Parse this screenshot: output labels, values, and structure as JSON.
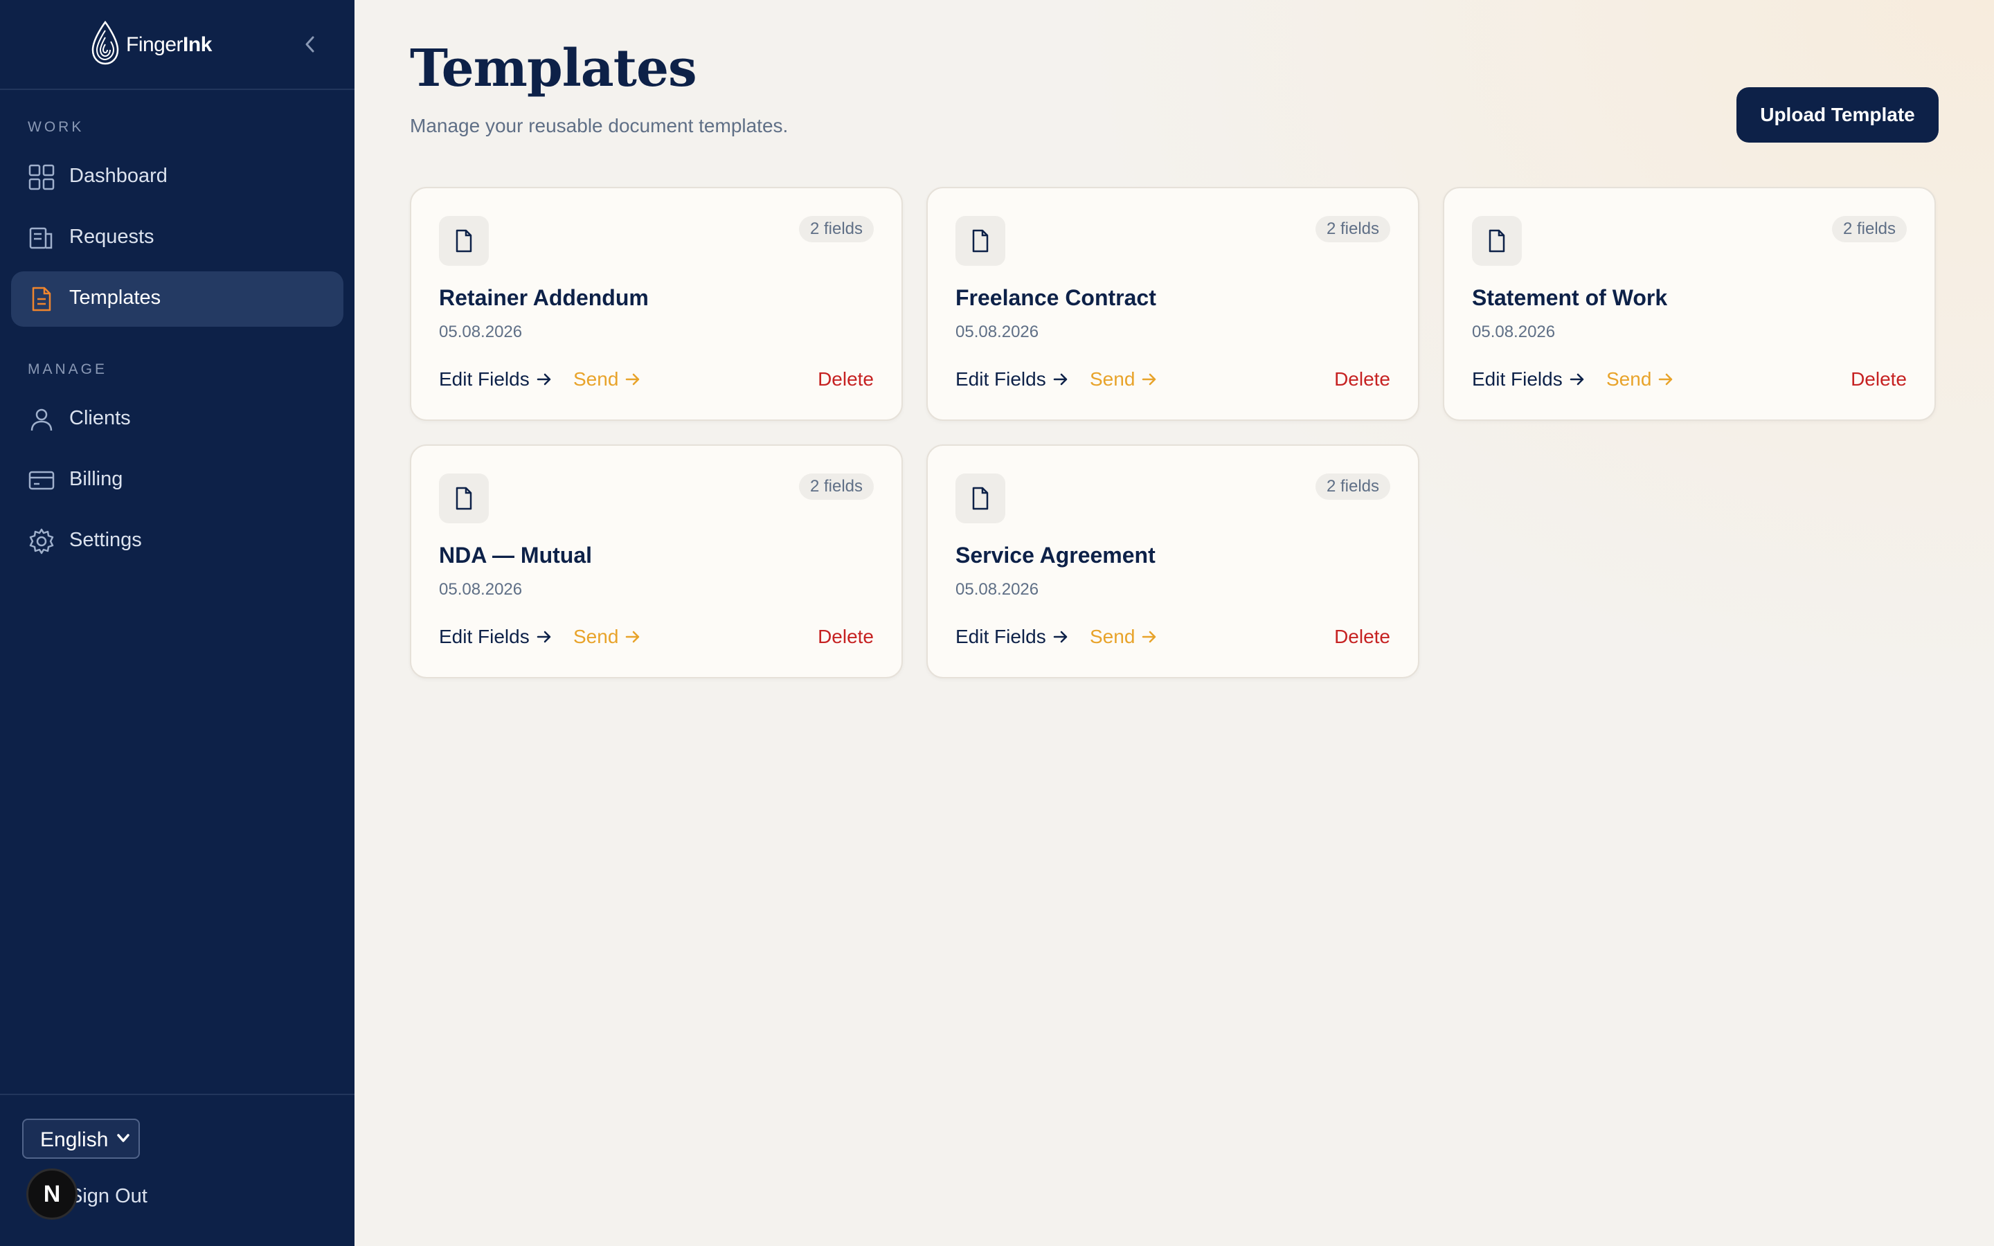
{
  "brand": {
    "name_light": "Finger",
    "name_bold": "Ink"
  },
  "sidebar": {
    "sections": [
      {
        "label": "WORK",
        "items": [
          {
            "label": "Dashboard",
            "icon": "dashboard-grid-icon",
            "active": false
          },
          {
            "label": "Requests",
            "icon": "requests-icon",
            "active": false
          },
          {
            "label": "Templates",
            "icon": "template-document-icon",
            "active": true
          }
        ]
      },
      {
        "label": "MANAGE",
        "items": [
          {
            "label": "Clients",
            "icon": "user-icon",
            "active": false
          },
          {
            "label": "Billing",
            "icon": "credit-card-icon",
            "active": false
          },
          {
            "label": "Settings",
            "icon": "gear-icon",
            "active": false
          }
        ]
      }
    ],
    "footer": {
      "language": "English",
      "sign_out": "Sign Out",
      "avatar_letter": "N"
    }
  },
  "header": {
    "title": "Templates",
    "subtitle": "Manage your reusable document templates.",
    "upload_label": "Upload Template"
  },
  "templates": [
    {
      "name": "Retainer Addendum",
      "date": "05.08.2026",
      "fields": "2 fields",
      "edit": "Edit Fields",
      "send": "Send",
      "delete": "Delete"
    },
    {
      "name": "Freelance Contract",
      "date": "05.08.2026",
      "fields": "2 fields",
      "edit": "Edit Fields",
      "send": "Send",
      "delete": "Delete"
    },
    {
      "name": "Statement of Work",
      "date": "05.08.2026",
      "fields": "2 fields",
      "edit": "Edit Fields",
      "send": "Send",
      "delete": "Delete"
    },
    {
      "name": "NDA — Mutual",
      "date": "05.08.2026",
      "fields": "2 fields",
      "edit": "Edit Fields",
      "send": "Send",
      "delete": "Delete"
    },
    {
      "name": "Service Agreement",
      "date": "05.08.2026",
      "fields": "2 fields",
      "edit": "Edit Fields",
      "send": "Send",
      "delete": "Delete"
    }
  ],
  "colors": {
    "sidebar_bg": "#0d2148",
    "active_item_bg": "#243a63",
    "accent_orange": "#e8a32a",
    "delete_red": "#c62222",
    "primary_navy": "#0d2148"
  }
}
